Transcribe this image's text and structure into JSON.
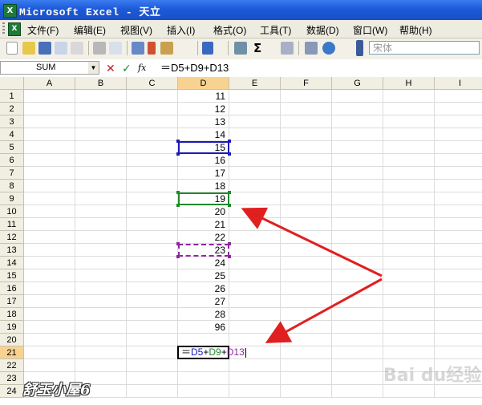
{
  "window": {
    "title": "Microsoft Excel - 天立",
    "app_icon": "excel-icon"
  },
  "menu": {
    "items": [
      {
        "label": "文件(F)"
      },
      {
        "label": "编辑(E)"
      },
      {
        "label": "视图(V)"
      },
      {
        "label": "插入(I)"
      },
      {
        "label": "格式(O)"
      },
      {
        "label": "工具(T)"
      },
      {
        "label": "数据(D)"
      },
      {
        "label": "窗口(W)"
      },
      {
        "label": "帮助(H)"
      }
    ]
  },
  "toolbar": {
    "font_value": "宋体",
    "autosum_label": "Σ"
  },
  "formula_bar": {
    "name_box": "SUM",
    "cancel": "✕",
    "enter": "✓",
    "fx": "fx",
    "formula": "＝D5+D9+D13"
  },
  "sheet": {
    "columns": [
      "A",
      "B",
      "C",
      "D",
      "E",
      "F",
      "G",
      "H",
      "I"
    ],
    "rows": [
      "1",
      "2",
      "3",
      "4",
      "5",
      "6",
      "7",
      "8",
      "9",
      "10",
      "11",
      "12",
      "13",
      "14",
      "15",
      "16",
      "17",
      "18",
      "19",
      "20",
      "21",
      "22",
      "23",
      "24"
    ],
    "d_values": [
      "11",
      "12",
      "13",
      "14",
      "15",
      "16",
      "17",
      "18",
      "19",
      "20",
      "21",
      "22",
      "23",
      "24",
      "25",
      "26",
      "27",
      "28",
      "96"
    ],
    "active_column": "D",
    "active_row": "21",
    "edit_cell_formula": {
      "eq": "＝",
      "r1": "D5",
      "plus1": "+",
      "r2": "D9",
      "plus2": "+",
      "r3": "D13"
    }
  },
  "colors": {
    "ref1": "#1a1ab8",
    "ref2": "#1f8a2a",
    "ref3": "#8a2a9a",
    "arrow": "#e02020"
  },
  "watermark": {
    "left_text": "舒玉小屋6",
    "right_text": "Bai du经验"
  }
}
